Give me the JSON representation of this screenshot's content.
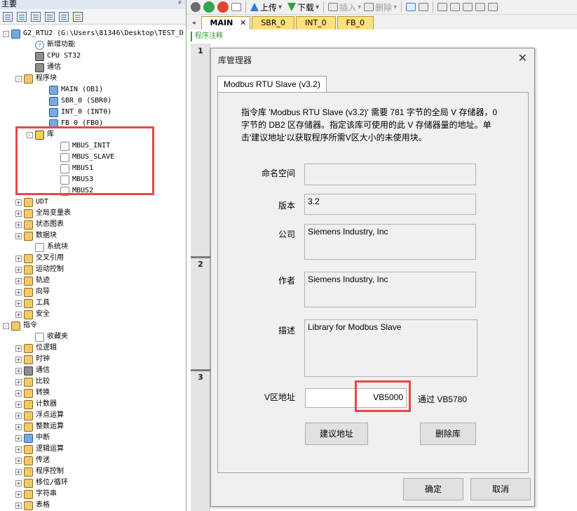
{
  "left_panel": {
    "title": "主要",
    "pin": "ᵖ",
    "tree": [
      {
        "label": "G2_RTU2 (G:\\Users\\81346\\Desktop\\TEST_D",
        "icon": "project-icon",
        "expander": "-"
      },
      {
        "label": "新增功能",
        "icon": "help-icon"
      },
      {
        "label": "CPU ST32",
        "icon": "cpu-icon"
      },
      {
        "label": "通信",
        "icon": "communication-icon"
      },
      {
        "label": "程序块",
        "icon": "folder-icon",
        "expander": "-"
      },
      {
        "label": "MAIN (OB1)",
        "icon": "program-block-icon"
      },
      {
        "label": "SBR_0 (SBR0)",
        "icon": "subroutine-icon"
      },
      {
        "label": "INT_0 (INT0)",
        "icon": "interrupt-icon"
      },
      {
        "label": "FB_0 (FB0)",
        "icon": "function-block-icon"
      },
      {
        "label": "库",
        "icon": "library-icon",
        "expander": "-"
      },
      {
        "label": "MBUS_INIT",
        "icon": "library-block-icon"
      },
      {
        "label": "MBUS_SLAVE",
        "icon": "library-block-icon"
      },
      {
        "label": "MBUS1",
        "icon": "library-block-icon"
      },
      {
        "label": "MBUS3",
        "icon": "library-block-icon"
      },
      {
        "label": "MBUS2",
        "icon": "library-block-icon"
      },
      {
        "label": "UDT",
        "icon": "folder-icon",
        "expander": "+"
      },
      {
        "label": "全局变量表",
        "icon": "table-icon",
        "expander": "+"
      },
      {
        "label": "状态图表",
        "icon": "table-icon",
        "expander": "+"
      },
      {
        "label": "数据块",
        "icon": "folder-icon",
        "expander": "+"
      },
      {
        "label": "系统块",
        "icon": "system-block-icon"
      },
      {
        "label": "交叉引用",
        "icon": "cross-reference-icon",
        "expander": "+"
      },
      {
        "label": "运动控制",
        "icon": "motion-icon",
        "expander": "+"
      },
      {
        "label": "轨迹",
        "icon": "trace-icon",
        "expander": "+"
      },
      {
        "label": "向导",
        "icon": "wizard-icon",
        "expander": "+"
      },
      {
        "label": "工具",
        "icon": "tools-icon",
        "expander": "+"
      },
      {
        "label": "安全",
        "icon": "security-icon",
        "expander": "+"
      },
      {
        "label": "指令",
        "icon": "folder-icon",
        "expander": "-"
      },
      {
        "label": "收藏夹",
        "icon": "favorites-icon"
      },
      {
        "label": "位逻辑",
        "icon": "bit-logic-icon",
        "expander": "+"
      },
      {
        "label": "时钟",
        "icon": "clock-icon",
        "expander": "+"
      },
      {
        "label": "通信",
        "icon": "communication-icon",
        "expander": "+"
      },
      {
        "label": "比较",
        "icon": "compare-icon",
        "expander": "+"
      },
      {
        "label": "转换",
        "icon": "convert-icon",
        "expander": "+"
      },
      {
        "label": "计数器",
        "icon": "counter-icon",
        "expander": "+"
      },
      {
        "label": "浮点运算",
        "icon": "float-math-icon",
        "expander": "+"
      },
      {
        "label": "整数运算",
        "icon": "integer-math-icon",
        "expander": "+"
      },
      {
        "label": "中断",
        "icon": "interrupt-icon",
        "expander": "+"
      },
      {
        "label": "逻辑运算",
        "icon": "logic-op-icon",
        "expander": "+"
      },
      {
        "label": "传送",
        "icon": "move-icon",
        "expander": "+"
      },
      {
        "label": "程序控制",
        "icon": "program-control-icon",
        "expander": "+"
      },
      {
        "label": "移位/循环",
        "icon": "shift-icon",
        "expander": "+"
      },
      {
        "label": "字符串",
        "icon": "string-icon",
        "expander": "+"
      },
      {
        "label": "表格",
        "icon": "table-icon",
        "expander": "+"
      }
    ]
  },
  "toolbar": {
    "upload_label": "上传",
    "download_label": "下载",
    "insert_label": "插入",
    "delete_label": "删除",
    "dropdown": "▾"
  },
  "tabs": {
    "nav": "◂",
    "items": [
      {
        "label": "MAIN",
        "active": true,
        "close": "✕"
      },
      {
        "label": "SBR_0"
      },
      {
        "label": "INT_0"
      },
      {
        "label": "FB_0"
      }
    ]
  },
  "editor": {
    "comment": "程序注释",
    "networks": [
      "1",
      "2",
      "3"
    ]
  },
  "dialog": {
    "title": "库管理器",
    "close": "✕",
    "tab": "Modbus RTU Slave (v3.2)",
    "description": "指令库 'Modbus RTU Slave (v3.2)' 需要 781 字节的全局 V 存储器，0 字节的 DB2 区存储器。指定该库可使用的此 V 存储器量的地址。单击'建议地址'以获取程序所需V区大小的未使用块。",
    "namespace_label": "命名空间",
    "namespace_value": "",
    "version_label": "版本",
    "version_value": "3.2",
    "company_label": "公司",
    "company_value": "Siemens Industry, Inc",
    "author_label": "作者",
    "author_value": "Siemens Industry, Inc",
    "desc_label": "描述",
    "desc_value": "Library for Modbus Slave",
    "vaddr_label": "V区地址",
    "vaddr_value": "VB5000",
    "vaddr_through": "通过 VB5780",
    "suggest_button": "建议地址",
    "delete_button": "删除库",
    "ok_button": "确定",
    "cancel_button": "取消"
  },
  "colors": {
    "highlight": "#e8474a",
    "tab_yellow": "#ffe07a",
    "comment_green": "#2e9e3c"
  }
}
